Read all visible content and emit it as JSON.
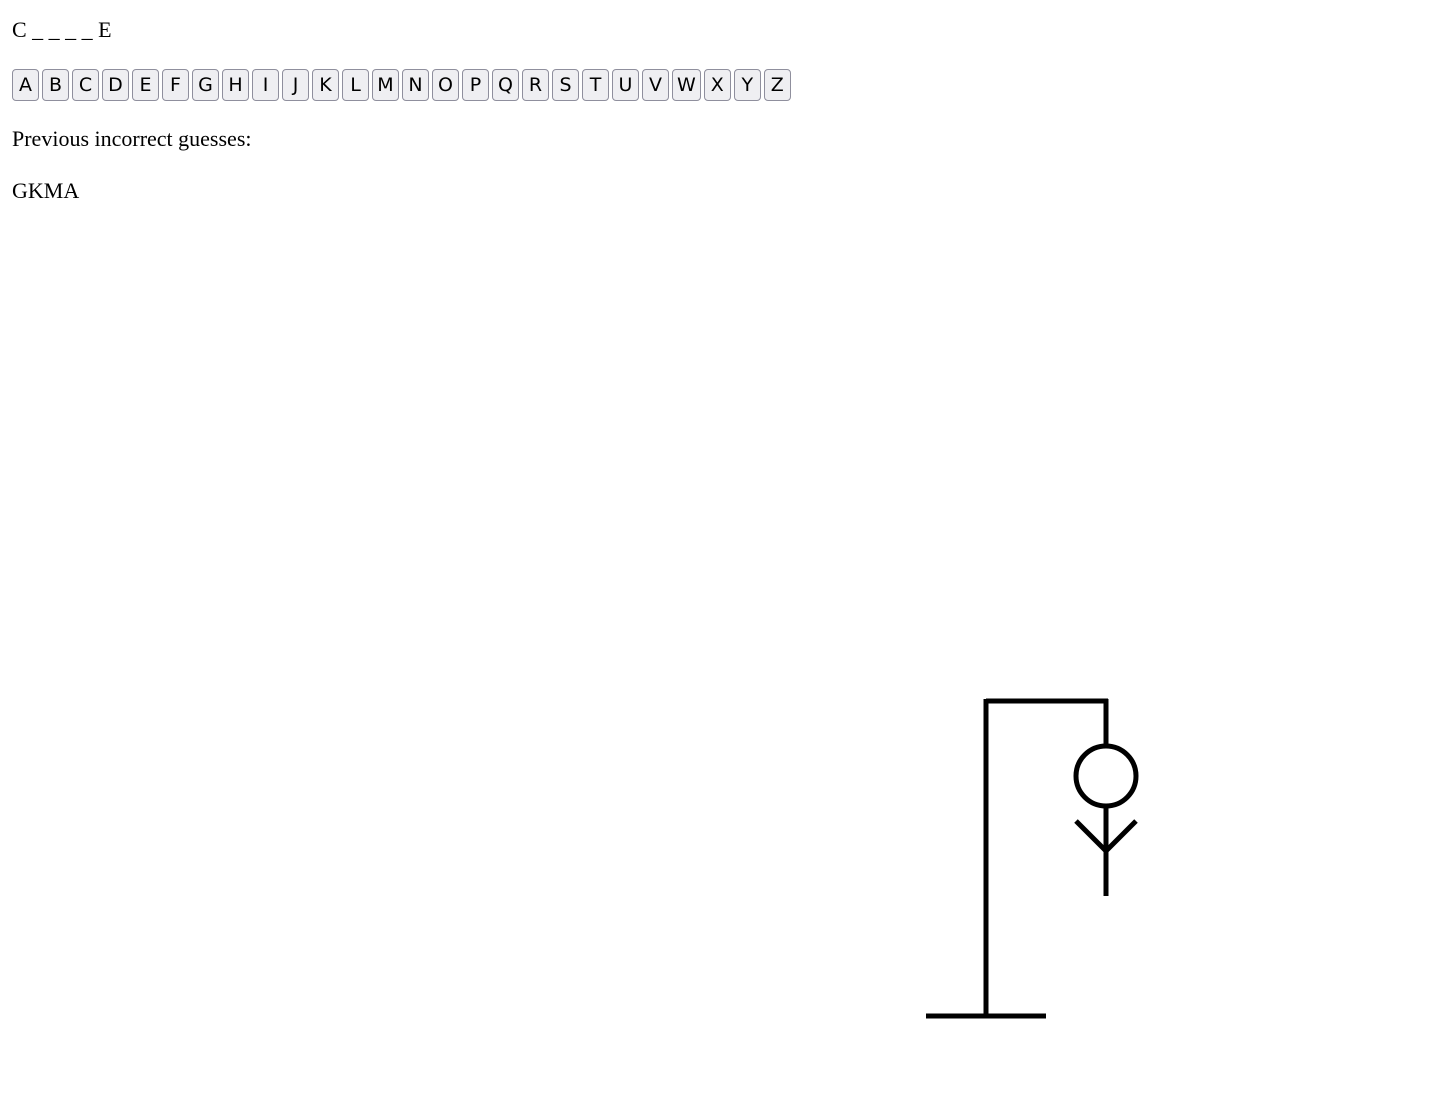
{
  "word": {
    "display": "C _ _ _ _ E"
  },
  "keyboard": {
    "letters": [
      "A",
      "B",
      "C",
      "D",
      "E",
      "F",
      "G",
      "H",
      "I",
      "J",
      "K",
      "L",
      "M",
      "N",
      "O",
      "P",
      "Q",
      "R",
      "S",
      "T",
      "U",
      "V",
      "W",
      "X",
      "Y",
      "Z"
    ]
  },
  "guesses": {
    "label": "Previous incorrect guesses:",
    "incorrect": "GKMA"
  },
  "hangman": {
    "parts_shown": [
      "base",
      "pole",
      "beam",
      "rope",
      "head",
      "body",
      "arms"
    ],
    "stroke_color": "#000000"
  }
}
